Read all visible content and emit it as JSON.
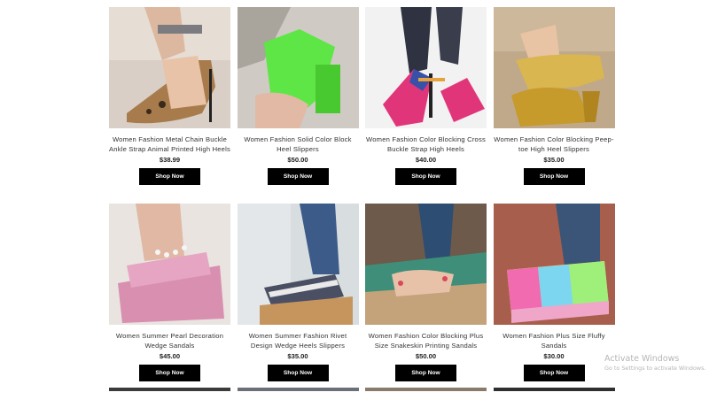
{
  "products": [
    {
      "title": "Women Fashion Metal Chain Buckle Ankle Strap Animal Printed High Heels",
      "price": "$38.99",
      "button": "Shop Now",
      "image": "leopard-heel-image"
    },
    {
      "title": "Women Fashion Solid Color Block Heel Slippers",
      "price": "$50.00",
      "button": "Shop Now",
      "image": "green-block-heel-image"
    },
    {
      "title": "Women Fashion Color Blocking Cross Buckle Strap High Heels",
      "price": "$40.00",
      "button": "Shop Now",
      "image": "pink-blue-heel-image"
    },
    {
      "title": "Women Fashion Color Blocking Peep-toe High Heel Slippers",
      "price": "$35.00",
      "button": "Shop Now",
      "image": "gold-slipper-image"
    },
    {
      "title": "Women Summer Pearl Decoration Wedge Sandals",
      "price": "$45.00",
      "button": "Shop Now",
      "image": "pink-wedge-image"
    },
    {
      "title": "Women Summer Fashion Rivet Design Wedge Heels Slippers",
      "price": "$35.00",
      "button": "Shop Now",
      "image": "striped-wedge-image"
    },
    {
      "title": "Women Fashion Color Blocking Plus Size Snakeskin Printing Sandals",
      "price": "$50.00",
      "button": "Shop Now",
      "image": "snakeskin-sandal-image"
    },
    {
      "title": "Women Fashion Plus Size Fluffy Sandals",
      "price": "$30.00",
      "button": "Shop Now",
      "image": "fluffy-sandal-image"
    }
  ],
  "watermark": {
    "line1": "Activate Windows",
    "line2": "Go to Settings to activate Windows."
  }
}
